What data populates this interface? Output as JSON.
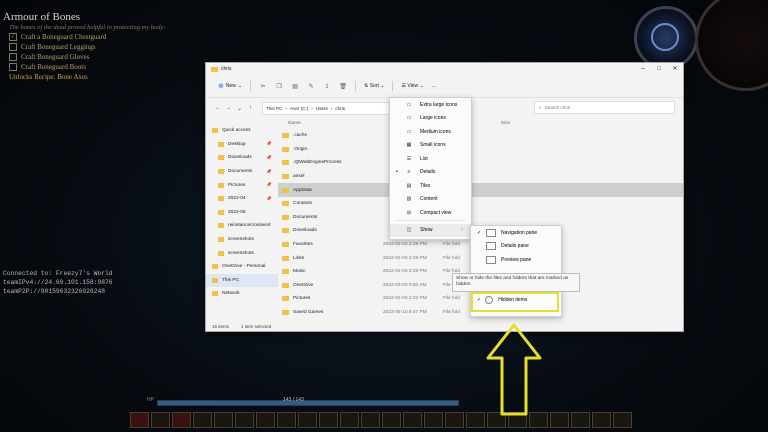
{
  "game": {
    "quest": {
      "title": "Armour of Bones",
      "subtitle": "The bones of the dead proved helpful in protecting my body:",
      "tasks": [
        {
          "label": "Craft a Boneguard Chestguard",
          "done": true
        },
        {
          "label": "Craft Boneguard Leggings",
          "done": false
        },
        {
          "label": "Craft Boneguard Gloves",
          "done": false
        },
        {
          "label": "Craft Boneguard Boots",
          "done": false
        }
      ],
      "unlock": "Unlocks Recipe: Bone Axes"
    },
    "connection": {
      "line1": "Connected to: Freezy7's World",
      "line2": "teamIPv4://24.69.101.158:9876",
      "line3": "teamP2P://90159632326026248"
    },
    "hp": {
      "label": "HP",
      "value": "143 / 143",
      "fraction": 1.0
    }
  },
  "explorer": {
    "window_title": "chris",
    "toolbar": {
      "new_label": "New",
      "sort_label": "Sort",
      "view_label": "View",
      "more_label": "..."
    },
    "address": {
      "segments": [
        "This PC",
        "Acer (C:)",
        "Users",
        "chris"
      ],
      "search_placeholder": "Search chris"
    },
    "columns": {
      "name": "Name",
      "size": "Size"
    },
    "nav_items": [
      {
        "label": "Quick access",
        "pin": false,
        "sel": false,
        "sub": false
      },
      {
        "label": "Desktop",
        "pin": true,
        "sel": false,
        "sub": true
      },
      {
        "label": "Downloads",
        "pin": true,
        "sel": false,
        "sub": true
      },
      {
        "label": "Documents",
        "pin": true,
        "sel": false,
        "sub": true
      },
      {
        "label": "Pictures",
        "pin": true,
        "sel": false,
        "sub": true
      },
      {
        "label": "2022-04",
        "pin": true,
        "sel": false,
        "sub": true
      },
      {
        "label": "2022-05",
        "pin": false,
        "sel": false,
        "sub": true
      },
      {
        "label": "reinstancecrossworl",
        "pin": false,
        "sel": false,
        "sub": true
      },
      {
        "label": "screenshots",
        "pin": false,
        "sel": false,
        "sub": true
      },
      {
        "label": "screenshots",
        "pin": false,
        "sel": false,
        "sub": true
      },
      {
        "label": "OneDrive - Personal",
        "pin": false,
        "sel": false,
        "sub": false
      },
      {
        "label": "This PC",
        "pin": false,
        "sel": true,
        "sub": false
      },
      {
        "label": "Network",
        "pin": false,
        "sel": false,
        "sub": false
      }
    ],
    "files": [
      {
        "name": ".cache",
        "date": "",
        "type": "",
        "sel": false
      },
      {
        "name": ".Origin",
        "date": "",
        "type": "",
        "sel": false
      },
      {
        "name": ".QtWebEngineProcess",
        "date": "",
        "type": "",
        "sel": false
      },
      {
        "name": "ansel",
        "date": "",
        "type": "",
        "sel": false
      },
      {
        "name": "AppData",
        "date": "",
        "type": "",
        "sel": true
      },
      {
        "name": "Contacts",
        "date": "",
        "type": "",
        "sel": false
      },
      {
        "name": "Documents",
        "date": "",
        "type": "",
        "sel": false
      },
      {
        "name": "Downloads",
        "date": "",
        "type": "",
        "sel": false
      },
      {
        "name": "Favorites",
        "date": "2022-02-03 2:29 PM",
        "type": "File fold",
        "sel": false
      },
      {
        "name": "Links",
        "date": "2022-02-03 2:49 PM",
        "type": "File fold",
        "sel": false
      },
      {
        "name": "Music",
        "date": "2022-02-03 2:29 PM",
        "type": "File fold",
        "sel": false
      },
      {
        "name": "OneDrive",
        "date": "2022-02-03 9:50 AM",
        "type": "File fold",
        "sel": false
      },
      {
        "name": "Pictures",
        "date": "2022-02-03 2:32 PM",
        "type": "File fold",
        "sel": false
      },
      {
        "name": "Saved Games",
        "date": "2022-05-10 6:47 PM",
        "type": "File fold",
        "sel": false
      }
    ],
    "status": {
      "count": "15 items",
      "selected": "1 item selected"
    }
  },
  "view_menu": {
    "items": [
      {
        "label": "Extra large icons",
        "icon": "monitor-icon",
        "checked": false
      },
      {
        "label": "Large icons",
        "icon": "monitor-icon",
        "checked": false
      },
      {
        "label": "Medium icons",
        "icon": "monitor-icon",
        "checked": false
      },
      {
        "label": "Small icons",
        "icon": "grid-icon",
        "checked": false
      },
      {
        "label": "List",
        "icon": "list-icon",
        "checked": false
      },
      {
        "label": "Details",
        "icon": "details-icon",
        "checked": true
      },
      {
        "label": "Tiles",
        "icon": "tiles-icon",
        "checked": false
      },
      {
        "label": "Content",
        "icon": "content-icon",
        "checked": false
      },
      {
        "label": "Compact view",
        "icon": "compact-icon",
        "checked": false
      }
    ],
    "show_label": "Show"
  },
  "show_submenu": {
    "items": [
      {
        "label": "Navigation pane",
        "checked": true
      },
      {
        "label": "Details pane",
        "checked": false
      },
      {
        "label": "Preview pane",
        "checked": false
      }
    ],
    "tooltip": "Show or hide the files and folders that are marked as hidden.",
    "hidden_items_label": "Hidden items"
  },
  "colors": {
    "highlight": "#e6de2c",
    "arrow": "#e6de2c",
    "folder": "#f0c24b"
  }
}
